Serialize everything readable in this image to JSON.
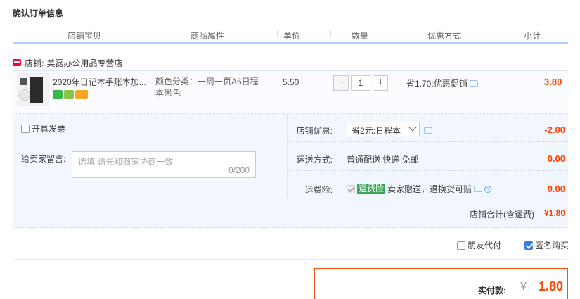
{
  "title": "确认订单信息",
  "table_headers": [
    "店铺宝贝",
    "商品属性",
    "单价",
    "数量",
    "优惠方式",
    "小计"
  ],
  "shop": {
    "label": "店铺:",
    "name": "美磊办公用品专营店"
  },
  "item": {
    "name": "2020年日记本手账本加...",
    "property": "颜色分类：一周一页A6日程本黑色",
    "unit_price": "5.50",
    "quantity": "1",
    "minus": "−",
    "plus": "+",
    "discount": "省1.70:优惠促销",
    "subtotal": "3.80"
  },
  "invoice": {
    "label": "开具发票"
  },
  "message": {
    "label": "给卖家留言:",
    "placeholder": "选填,请先和商家协商一致",
    "count": "0/200"
  },
  "shop_coupon": {
    "label": "店铺优惠:",
    "selected": "省2元:日程本",
    "value": "-2.00"
  },
  "shipping": {
    "label": "运送方式:",
    "method": "普通配送 快递 免邮",
    "value": "0.00"
  },
  "insurance": {
    "label": "运费险:",
    "tag": "运费险",
    "text": "卖家赠送，退换货可赔",
    "value": "0.00"
  },
  "shop_total": {
    "label": "店铺合计(含运费)",
    "value": "¥1.80"
  },
  "options": {
    "friend_pay": "朋友代付",
    "anonymous": "匿名购买"
  },
  "payment": {
    "label": "实付款:",
    "currency": "¥",
    "value": "1.80"
  },
  "colors": {
    "accent": "#ff4400",
    "header_border": "#b2d1ff",
    "panel_bg": "#f2f7ff",
    "checkbox_blue": "#3b7ddd",
    "insurance_green": "#3aa657"
  }
}
